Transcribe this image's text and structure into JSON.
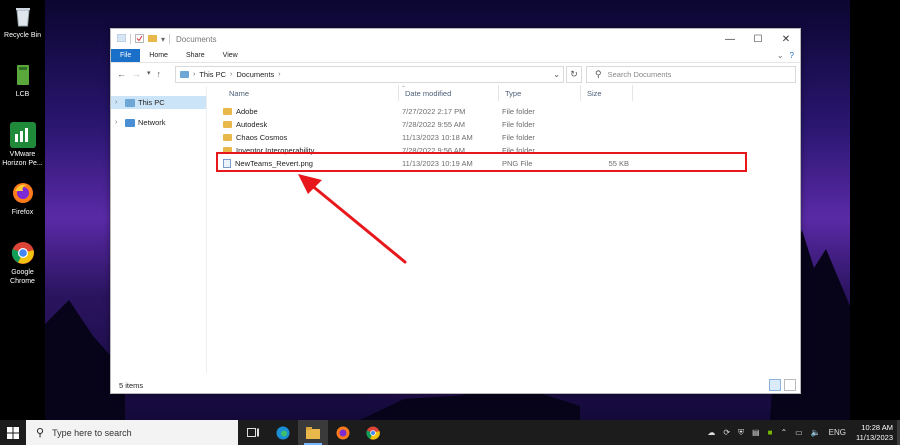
{
  "desktop": {
    "icons": [
      {
        "label": "Recycle Bin",
        "icon": "recycle-bin-icon"
      },
      {
        "label": "LCB",
        "icon": "book-icon"
      },
      {
        "label": "VMware Horizon Pe...",
        "icon": "vmware-icon"
      },
      {
        "label": "Firefox",
        "icon": "firefox-icon"
      },
      {
        "label": "Google Chrome",
        "icon": "chrome-icon"
      }
    ]
  },
  "explorer": {
    "title": "Documents",
    "ribbon_tabs": [
      "File",
      "Home",
      "Share",
      "View"
    ],
    "breadcrumb": [
      "This PC",
      "Documents"
    ],
    "search_placeholder": "Search Documents",
    "nav_pane": [
      "This PC",
      "Network"
    ],
    "columns": [
      "Name",
      "Date modified",
      "Type",
      "Size"
    ],
    "files": [
      {
        "name": "Adobe",
        "date": "7/27/2022 2:17 PM",
        "type": "File folder",
        "size": "",
        "icon": "folder-icon"
      },
      {
        "name": "Autodesk",
        "date": "7/28/2022 9:55 AM",
        "type": "File folder",
        "size": "",
        "icon": "folder-icon"
      },
      {
        "name": "Chaos Cosmos",
        "date": "11/13/2023 10:18 AM",
        "type": "File folder",
        "size": "",
        "icon": "folder-icon"
      },
      {
        "name": "Inventor Interoperability",
        "date": "7/28/2022 9:56 AM",
        "type": "File folder",
        "size": "",
        "icon": "folder-icon"
      },
      {
        "name": "NewTeams_Revert.png",
        "date": "11/13/2023 10:19 AM",
        "type": "PNG File",
        "size": "55 KB",
        "icon": "png-file-icon"
      }
    ],
    "status_count": "5 items",
    "highlight_color": "#e8171c"
  },
  "taskbar": {
    "search_placeholder": "Type here to search",
    "language": "ENG",
    "time": "10:28 AM",
    "date": "11/13/2023"
  }
}
